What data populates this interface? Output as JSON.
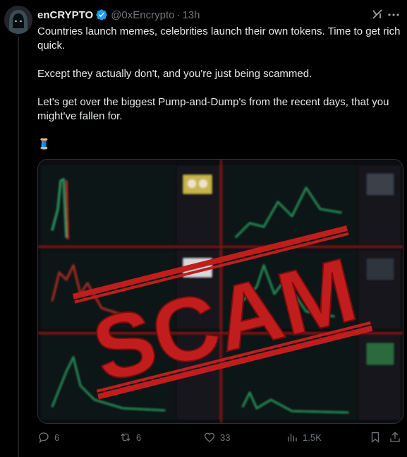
{
  "author": {
    "name": "enCRYPTO",
    "handle": "@0xEncrypto",
    "separator": "·",
    "time": "13h",
    "verified": true
  },
  "tweet": {
    "paragraphs": [
      "Countries launch memes, celebrities launch their own tokens. Time to get rich quick.",
      "Except they actually don't, and you're just being scammed.",
      "Let's get over the biggest Pump-and-Dump's from the recent days, that you might've fallen for."
    ],
    "thread_emoji": "🧵"
  },
  "media": {
    "stamp_text": "SCAM",
    "stamp_color": "#c21d1d"
  },
  "actions": {
    "replies": "6",
    "reposts": "6",
    "likes": "33",
    "views": "1.5K"
  },
  "colors": {
    "background": "#000000",
    "text": "#e7e9ea",
    "muted": "#71767b",
    "verified": "#1d9bf0"
  }
}
